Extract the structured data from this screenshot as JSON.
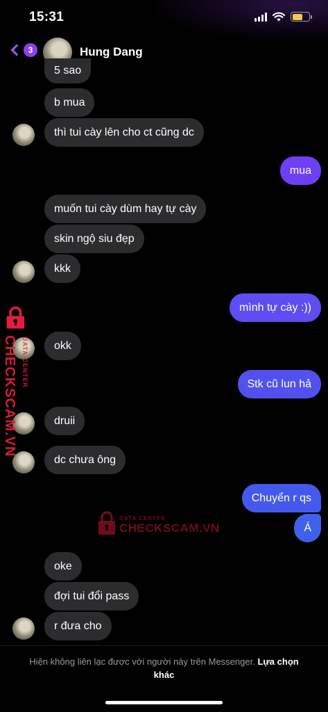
{
  "status_bar": {
    "time": "15:31",
    "battery_level": 0.64
  },
  "header": {
    "back_badge": "3",
    "contact_name": "Hung Dang"
  },
  "colors": {
    "accent": "#9b5cf6",
    "incoming_bubble": "#2c2c2e",
    "watermark": "#e11d3c"
  },
  "messages": [
    {
      "side": "in",
      "text": "5 sao"
    },
    {
      "side": "in",
      "text": "b mua"
    },
    {
      "side": "in",
      "text": "thì tui cày lên cho ct cũng dc"
    },
    {
      "side": "out",
      "text": "mua"
    },
    {
      "side": "in",
      "text": "muốn tui cày dùm hay tự cày"
    },
    {
      "side": "in",
      "text": "skin ngộ siu đẹp"
    },
    {
      "side": "in",
      "text": "kkk"
    },
    {
      "side": "out",
      "text": "mình tự cày :))"
    },
    {
      "side": "in",
      "text": "okk"
    },
    {
      "side": "out",
      "text": "Stk cũ lun hả"
    },
    {
      "side": "in",
      "text": "druii"
    },
    {
      "side": "in",
      "text": "dc chưa ông"
    },
    {
      "side": "out",
      "text": "Chuyển r qs"
    },
    {
      "side": "out",
      "text": "Á"
    },
    {
      "side": "in",
      "text": "oke"
    },
    {
      "side": "in",
      "text": "đợi tui đổi pass"
    },
    {
      "side": "in",
      "text": "r đưa cho"
    }
  ],
  "watermark": {
    "brand": "CHECKSCAM.VN",
    "subtitle": "DATA CENTER"
  },
  "footer": {
    "notice": "Hiện không liên lạc được với người này trên Messenger.",
    "link": "Lựa chọn khác"
  }
}
